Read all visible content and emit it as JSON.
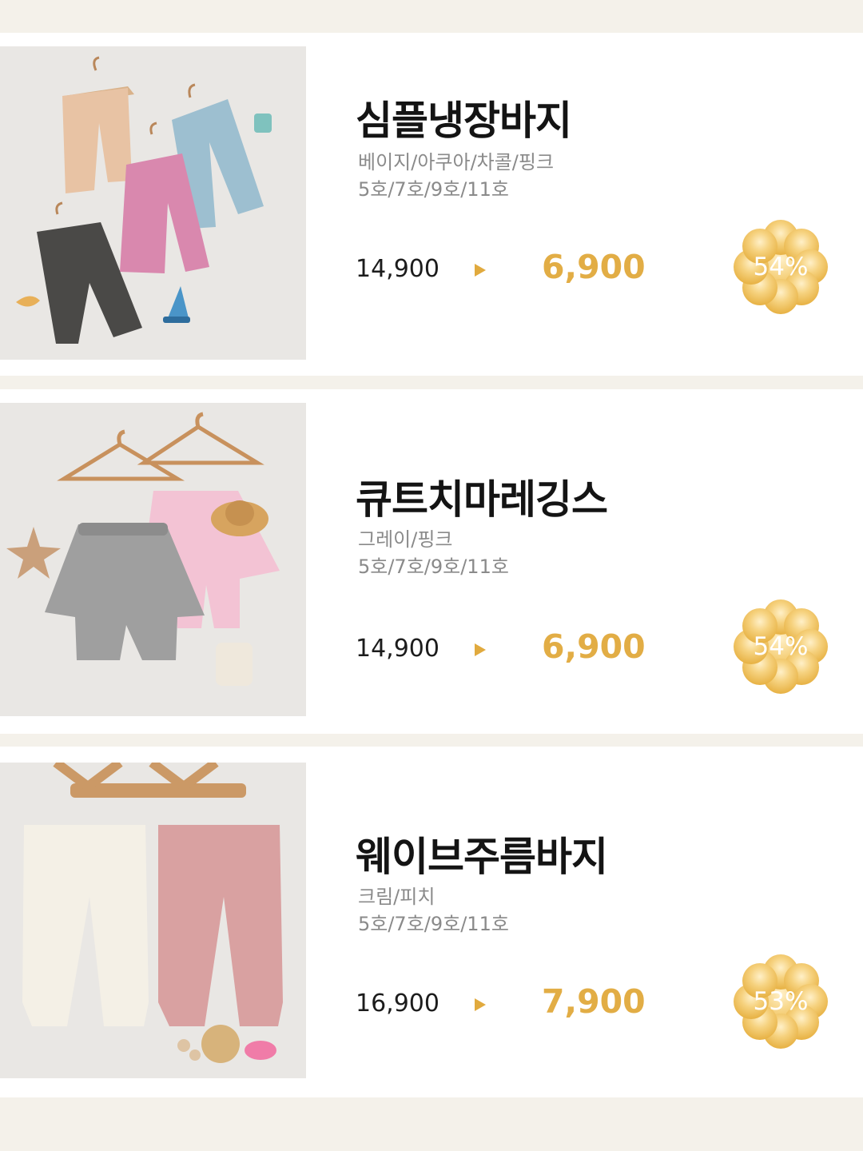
{
  "products": [
    {
      "name": "심플냉장바지",
      "colors": "베이지/아쿠아/차콜/핑크",
      "sizes": "5호/7호/9호/11호",
      "original_price": "14,900",
      "sale_price": "6,900",
      "discount": "54%"
    },
    {
      "name": "큐트치마레깅스",
      "colors": "그레이/핑크",
      "sizes": "5호/7호/9호/11호",
      "original_price": "14,900",
      "sale_price": "6,900",
      "discount": "54%"
    },
    {
      "name": "웨이브주름바지",
      "colors": "크림/피치",
      "sizes": "5호/7호/9호/11호",
      "original_price": "16,900",
      "sale_price": "7,900",
      "discount": "53%"
    }
  ],
  "colors": {
    "page_background": "#f4f1ea",
    "card_background": "#ffffff",
    "sale_price": "#e2ad45",
    "arrow": "#e1aa3e",
    "badge_gold": "#efbf57"
  }
}
